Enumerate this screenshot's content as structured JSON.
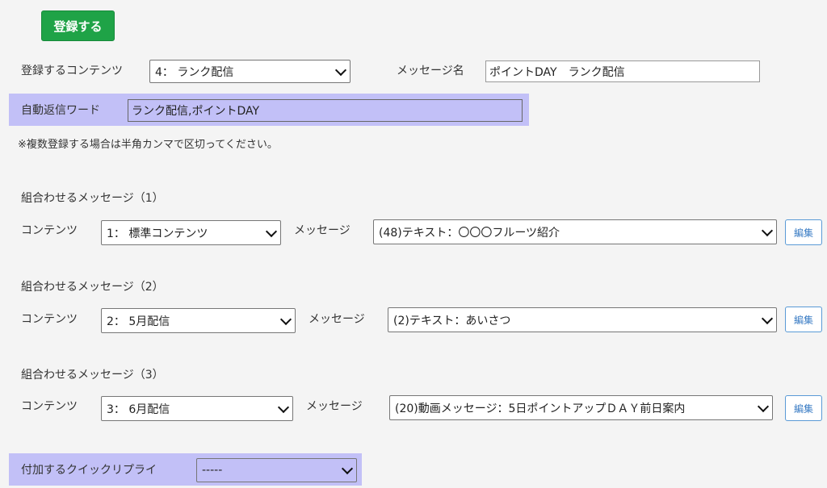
{
  "register_button": "登録する",
  "content_row": {
    "label": "登録するコンテンツ",
    "selected": "4： ランク配信",
    "message_name_label": "メッセージ名",
    "message_name_value": "ポイントDAY　ランク配信"
  },
  "auto_reply": {
    "label": "自動返信ワード",
    "value": "ランク配信,ポイントDAY"
  },
  "note": "※複数登録する場合は半角カンマで区切ってください。",
  "combos": [
    {
      "title": "組合わせるメッセージ（1）",
      "contents_label": "コンテンツ",
      "contents_value": "1： 標準コンテンツ",
      "message_label": "メッセージ",
      "message_value": "(48)テキスト：〇〇〇フルーツ紹介",
      "edit_label": "編集"
    },
    {
      "title": "組合わせるメッセージ（2）",
      "contents_label": "コンテンツ",
      "contents_value": "2： 5月配信",
      "message_label": "メッセージ",
      "message_value": "(2)テキスト：あいさつ",
      "edit_label": "編集"
    },
    {
      "title": "組合わせるメッセージ（3）",
      "contents_label": "コンテンツ",
      "contents_value": "3： 6月配信",
      "message_label": "メッセージ",
      "message_value": "(20)動画メッセージ：5日ポイントアップＤＡＹ前日案内",
      "edit_label": "編集"
    }
  ],
  "quick_reply": {
    "label": "付加するクイックリプライ",
    "value": "-----"
  },
  "colors": {
    "register_green": "#1fa347",
    "band_purple": "#c2c0f7",
    "edit_blue": "#3a7cc4"
  }
}
